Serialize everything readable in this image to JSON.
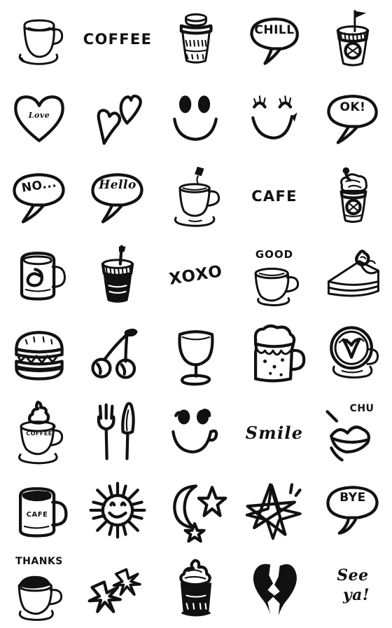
{
  "sheet": {
    "title": "Hand-drawn Cafe & Emoji Sticker Sheet",
    "background_color": "#ffffff",
    "ink_color": "#111111",
    "columns": 5,
    "rows": 8,
    "cell_size_px": 112,
    "style": "monochrome hand-drawn doodle line art"
  },
  "stickers": [
    {
      "row": 1,
      "col": 1,
      "name": "coffee-cup-saucer",
      "icon": "coffee-cup-on-saucer-icon",
      "label": ""
    },
    {
      "row": 1,
      "col": 2,
      "name": "coffee-word",
      "icon": "text-icon",
      "label": "COFFEE"
    },
    {
      "row": 1,
      "col": 3,
      "name": "takeaway-cup-lid",
      "icon": "takeaway-coffee-cup-icon",
      "label": ""
    },
    {
      "row": 1,
      "col": 4,
      "name": "chill-speech-bubble",
      "icon": "speech-bubble-icon",
      "label": "CHILL"
    },
    {
      "row": 1,
      "col": 5,
      "name": "iced-drink-flag",
      "icon": "iced-drink-cup-icon",
      "label": ""
    },
    {
      "row": 2,
      "col": 1,
      "name": "love-heart",
      "icon": "heart-icon",
      "label": "Love"
    },
    {
      "row": 2,
      "col": 2,
      "name": "two-hearts",
      "icon": "double-heart-icon",
      "label": ""
    },
    {
      "row": 2,
      "col": 3,
      "name": "smiley-face",
      "icon": "smiley-face-icon",
      "label": ""
    },
    {
      "row": 2,
      "col": 4,
      "name": "winking-lashes-face",
      "icon": "happy-face-lashes-icon",
      "label": ""
    },
    {
      "row": 2,
      "col": 5,
      "name": "ok-speech-bubble",
      "icon": "speech-bubble-icon",
      "label": "OK!"
    },
    {
      "row": 3,
      "col": 1,
      "name": "no-speech-bubble",
      "icon": "speech-bubble-icon",
      "label": "NO..."
    },
    {
      "row": 3,
      "col": 2,
      "name": "hello-speech-bubble",
      "icon": "speech-bubble-icon",
      "label": "Hello"
    },
    {
      "row": 3,
      "col": 3,
      "name": "steaming-coffee-cup",
      "icon": "hot-coffee-cup-icon",
      "label": ""
    },
    {
      "row": 3,
      "col": 4,
      "name": "cafe-word",
      "icon": "text-icon",
      "label": "CAFE"
    },
    {
      "row": 3,
      "col": 5,
      "name": "whipped-cream-drink",
      "icon": "frappe-with-cream-icon",
      "label": ""
    },
    {
      "row": 4,
      "col": 1,
      "name": "coffee-mug-swirl",
      "icon": "mug-icon",
      "label": ""
    },
    {
      "row": 4,
      "col": 2,
      "name": "iced-coffee-straw",
      "icon": "iced-coffee-cup-icon",
      "label": ""
    },
    {
      "row": 4,
      "col": 3,
      "name": "xoxo-word",
      "icon": "text-icon",
      "label": "XOXO"
    },
    {
      "row": 4,
      "col": 4,
      "name": "good-coffee-cup",
      "icon": "coffee-cup-icon",
      "label": "GOOD"
    },
    {
      "row": 4,
      "col": 5,
      "name": "cake-slice",
      "icon": "cake-slice-icon",
      "label": ""
    },
    {
      "row": 5,
      "col": 1,
      "name": "hamburger",
      "icon": "hamburger-icon",
      "label": ""
    },
    {
      "row": 5,
      "col": 2,
      "name": "cherries",
      "icon": "cherries-icon",
      "label": ""
    },
    {
      "row": 5,
      "col": 3,
      "name": "cocktail-glass",
      "icon": "wine-glass-icon",
      "label": ""
    },
    {
      "row": 5,
      "col": 4,
      "name": "beer-mug",
      "icon": "beer-mug-icon",
      "label": ""
    },
    {
      "row": 5,
      "col": 5,
      "name": "latte-art-cup",
      "icon": "latte-art-cup-icon",
      "label": ""
    },
    {
      "row": 6,
      "col": 1,
      "name": "coffee-cup-cream",
      "icon": "coffee-with-whipped-cream-icon",
      "label": "COFFEE"
    },
    {
      "row": 6,
      "col": 2,
      "name": "fork-and-knife",
      "icon": "cutlery-icon",
      "label": ""
    },
    {
      "row": 6,
      "col": 3,
      "name": "winking-smiley",
      "icon": "winking-face-icon",
      "label": ""
    },
    {
      "row": 6,
      "col": 4,
      "name": "smile-word",
      "icon": "text-icon",
      "label": "Smile"
    },
    {
      "row": 6,
      "col": 5,
      "name": "chu-kiss-lips",
      "icon": "kiss-lips-icon",
      "label": "CHU"
    },
    {
      "row": 7,
      "col": 1,
      "name": "cafe-mug",
      "icon": "mug-icon",
      "label": "CAFE"
    },
    {
      "row": 7,
      "col": 2,
      "name": "smiling-sun",
      "icon": "sun-face-icon",
      "label": ""
    },
    {
      "row": 7,
      "col": 3,
      "name": "moon-and-stars",
      "icon": "crescent-moon-star-icon",
      "label": ""
    },
    {
      "row": 7,
      "col": 4,
      "name": "sparkle-star",
      "icon": "star-icon",
      "label": ""
    },
    {
      "row": 7,
      "col": 5,
      "name": "bye-speech-bubble",
      "icon": "speech-bubble-icon",
      "label": "BYE"
    },
    {
      "row": 8,
      "col": 1,
      "name": "thanks-coffee-cup",
      "icon": "coffee-cup-icon",
      "label": "THANKS"
    },
    {
      "row": 8,
      "col": 2,
      "name": "two-flowers",
      "icon": "flower-icon",
      "label": ""
    },
    {
      "row": 8,
      "col": 3,
      "name": "ice-cream-cup",
      "icon": "soft-serve-cup-icon",
      "label": ""
    },
    {
      "row": 8,
      "col": 4,
      "name": "broken-heart",
      "icon": "broken-heart-icon",
      "label": ""
    },
    {
      "row": 8,
      "col": 5,
      "name": "see-ya-word",
      "icon": "text-icon",
      "label": "See ya!"
    }
  ]
}
